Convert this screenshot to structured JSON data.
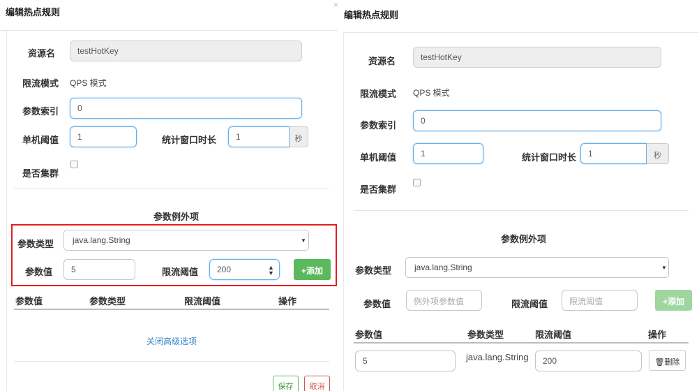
{
  "left_dialog": {
    "title": "编辑热点规则",
    "resource_label": "资源名",
    "resource_value": "testHotKey",
    "mode_label": "限流模式",
    "mode_value": "QPS 模式",
    "param_index_label": "参数索引",
    "param_index_value": "0",
    "threshold_label": "单机阈值",
    "threshold_value": "1",
    "window_label": "统计窗口时长",
    "window_value": "1",
    "window_unit": "秒",
    "cluster_label": "是否集群",
    "exception_title": "参数例外项",
    "param_type_label": "参数类型",
    "param_type_value": "java.lang.String",
    "param_value_label": "参数值",
    "param_value_value": "5",
    "limit_label": "限流阈值",
    "limit_value": "200",
    "add_button": "添加",
    "table_headers": [
      "参数值",
      "参数类型",
      "限流阈值",
      "操作"
    ],
    "close_advanced": "关闭高级选项",
    "save_button": "保存",
    "cancel_button": "取消"
  },
  "right_dialog": {
    "title": "编辑热点规则",
    "resource_label": "资源名",
    "resource_value": "testHotKey",
    "mode_label": "限流模式",
    "mode_value": "QPS 模式",
    "param_index_label": "参数索引",
    "param_index_value": "0",
    "threshold_label": "单机阈值",
    "threshold_value": "1",
    "window_label": "统计窗口时长",
    "window_value": "1",
    "window_unit": "秒",
    "cluster_label": "是否集群",
    "exception_title": "参数例外项",
    "param_type_label": "参数类型",
    "param_type_value": "java.lang.String",
    "param_value_label": "参数值",
    "param_value_placeholder": "例外项参数值",
    "limit_label": "限流阈值",
    "limit_placeholder": "限流阈值",
    "add_button": "添加",
    "table_headers": [
      "参数值",
      "参数类型",
      "限流阈值",
      "操作"
    ],
    "row": {
      "param_value": "5",
      "param_type": "java.lang.String",
      "limit": "200",
      "delete_button": "删除"
    }
  },
  "colors": {
    "highlight_box": "#e02020",
    "add_green": "#5cb85c",
    "link_blue": "#3a86c8"
  }
}
